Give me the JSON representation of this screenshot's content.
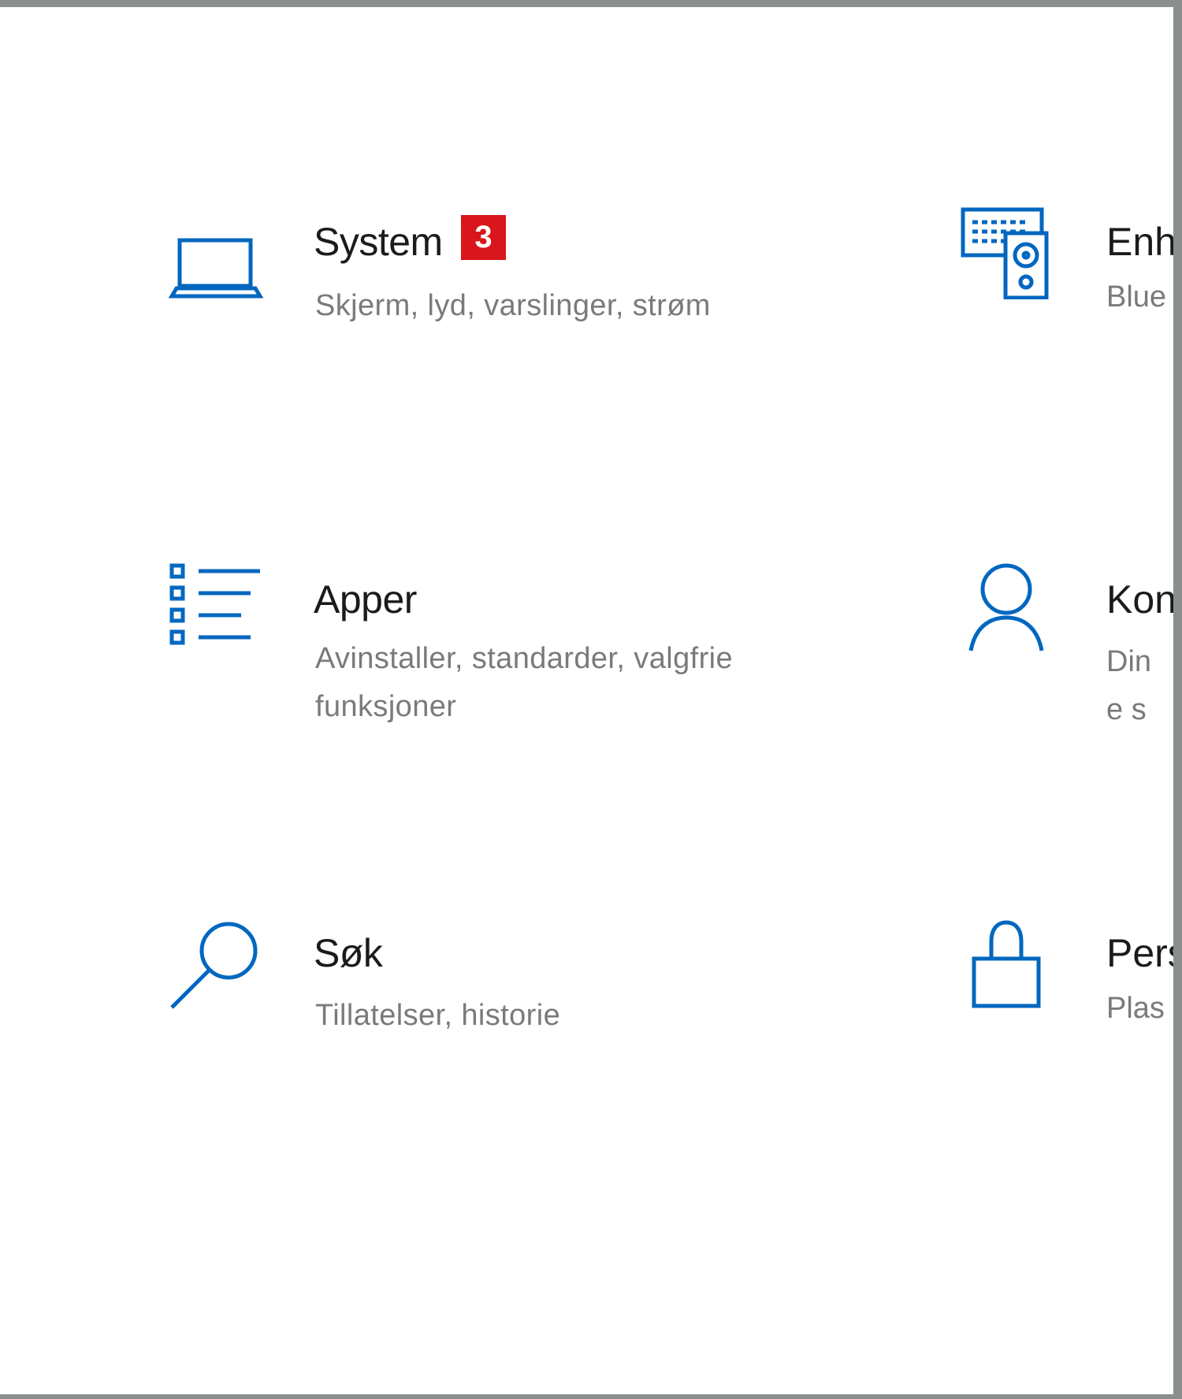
{
  "accent_color": "#0067c0",
  "badge_color": "#d8161b",
  "tiles": {
    "system": {
      "icon": "laptop-icon",
      "title": "System",
      "badge": "3",
      "desc": "Skjerm, lyd, varslinger, strøm"
    },
    "devices": {
      "icon": "devices-icon",
      "title": "Enh",
      "desc": "Blue"
    },
    "apps": {
      "icon": "apps-list-icon",
      "title": "Apper",
      "desc": "Avinstaller, standarder, valgfrie funksjoner"
    },
    "accounts": {
      "icon": "person-icon",
      "title": "Kon",
      "desc": "Dine synk"
    },
    "search": {
      "icon": "search-icon",
      "title": "Søk",
      "desc": "Tillatelser, historie"
    },
    "privacy": {
      "icon": "lock-icon",
      "title": "Pers",
      "desc": "Plas"
    }
  }
}
